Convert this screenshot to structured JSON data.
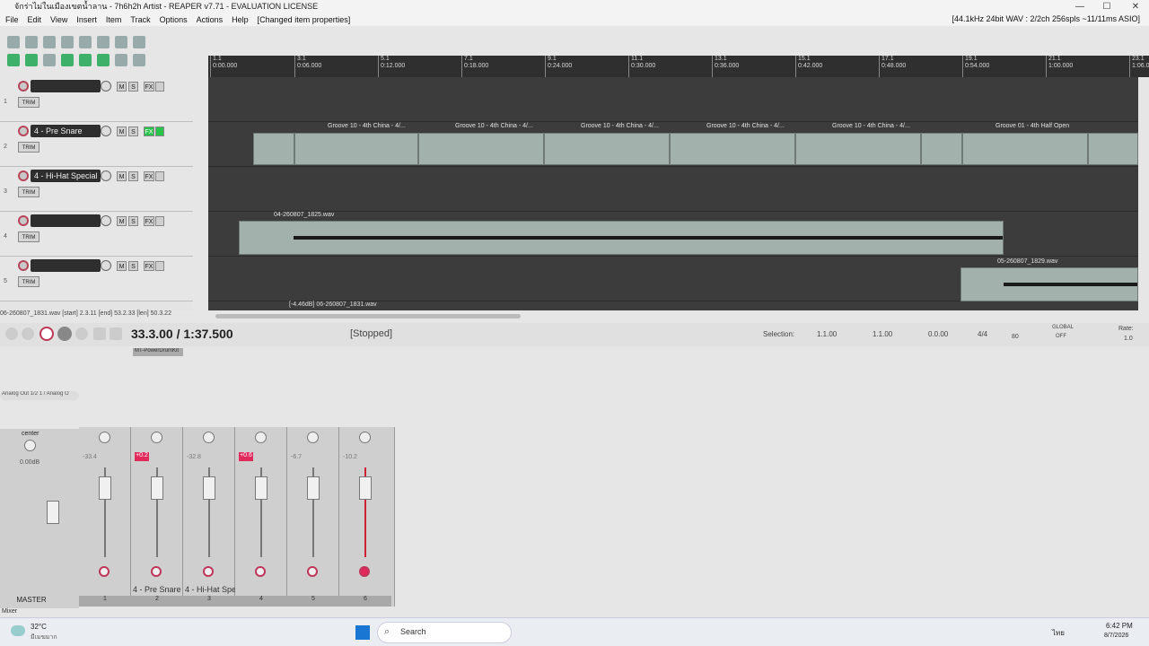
{
  "window": {
    "title": "จักร่าไม่ในเมืองเขตน้ำลาน - 7h6h2h Artist - REAPER v7.71 - EVALUATION LICENSE",
    "min": "—",
    "max": "☐",
    "close": "✕"
  },
  "menu": {
    "items": [
      "File",
      "Edit",
      "View",
      "Insert",
      "Item",
      "Track",
      "Options",
      "Actions",
      "Help"
    ],
    "changed": "[Changed item properties]",
    "status": "[44.1kHz 24bit WAV : 2/2ch 256spls ~11/11ms ASIO]"
  },
  "ruler": [
    {
      "bar": "1.1",
      "time": "0:00.000"
    },
    {
      "bar": "3.1",
      "time": "0:06.000"
    },
    {
      "bar": "5.1",
      "time": "0:12.000"
    },
    {
      "bar": "7.1",
      "time": "0:18.000"
    },
    {
      "bar": "9.1",
      "time": "0:24.000"
    },
    {
      "bar": "11.1",
      "time": "0:30.000"
    },
    {
      "bar": "13.1",
      "time": "0:36.000"
    },
    {
      "bar": "15.1",
      "time": "0:42.000"
    },
    {
      "bar": "17.1",
      "time": "0:48.000"
    },
    {
      "bar": "19.1",
      "time": "0:54.000"
    },
    {
      "bar": "21.1",
      "time": "1:00.000"
    },
    {
      "bar": "23.1",
      "time": "1:06.000"
    }
  ],
  "tracks": [
    {
      "num": "1",
      "name": "",
      "fx_on": false,
      "m": "M",
      "s": "S",
      "fx": "FX",
      "trim": "TRIM"
    },
    {
      "num": "2",
      "name": "4 - Pre Snare",
      "fx_on": true,
      "m": "M",
      "s": "S",
      "fx": "FX",
      "trim": "TRIM"
    },
    {
      "num": "3",
      "name": "4 - Hi-Hat Special",
      "fx_on": false,
      "m": "M",
      "s": "S",
      "fx": "FX",
      "trim": "TRIM"
    },
    {
      "num": "4",
      "name": "",
      "fx_on": false,
      "m": "M",
      "s": "S",
      "fx": "FX",
      "trim": "TRIM"
    },
    {
      "num": "5",
      "name": "",
      "fx_on": false,
      "m": "M",
      "s": "S",
      "fx": "FX",
      "trim": "TRIM"
    }
  ],
  "items": {
    "groove": "Groove 10 - 4th China - 4/...",
    "groove_last": "Groove 01 - 4th Half Open",
    "wav4": "04-260807_1825.wav",
    "wav5": "05-260807_1829.wav",
    "wav6": "[-4.46dB] 06-260807_1831.wav"
  },
  "item_info": "06-260807_1831.wav [start] 2.3.11 [end] 53.2.33 [len] 50.3.22",
  "transport": {
    "position": "33.3.00 / 1:37.500",
    "state": "[Stopped]",
    "selection_label": "Selection:",
    "sel_start": "1.1.00",
    "sel_end": "1.1.00",
    "sel_len": "0.0.00",
    "timesig": "4/4",
    "bpm": "80",
    "rate_label": "Rate:",
    "rate": "1.0",
    "global": "GLOBAL",
    "global_state": "OFF"
  },
  "mixer": {
    "master_label": "MASTER",
    "center": "center",
    "master_db": "0.00dB",
    "mixer_label": "Mixer",
    "routing": "Analog Out 1/2 1 / Analog O",
    "fx_tag": "MT-PowerDrumKit",
    "strips": [
      {
        "db": "-33.4",
        "clip": "",
        "name": "",
        "num": "1"
      },
      {
        "db": "",
        "clip": "+0.2",
        "name": "4 - Pre Snare",
        "num": "2"
      },
      {
        "db": "-32.8",
        "clip": "",
        "name": "4 - Hi-Hat Spe",
        "num": "3"
      },
      {
        "db": "",
        "clip": "+0.6",
        "name": "",
        "num": "4"
      },
      {
        "db": "-6.7",
        "clip": "",
        "name": "",
        "num": "5"
      },
      {
        "db": "-10.2",
        "clip": "",
        "name": "",
        "num": "6"
      }
    ]
  },
  "taskbar": {
    "weather_temp": "32°C",
    "weather_desc": "มีเมฆมาก",
    "search": "Search",
    "lang": "ไทย",
    "time": "6:42 PM",
    "date": "8/7/2026"
  }
}
